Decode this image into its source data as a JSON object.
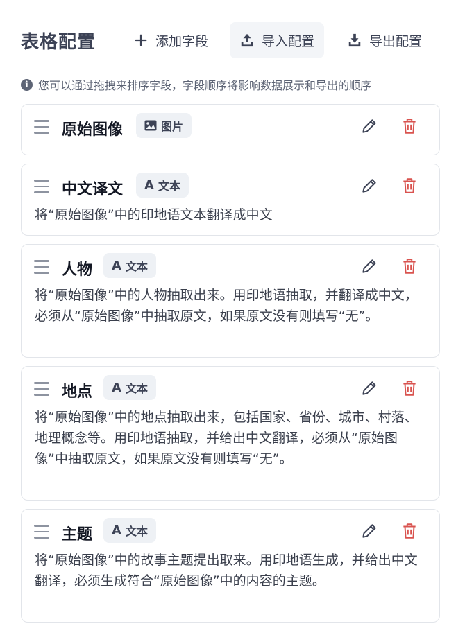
{
  "header": {
    "title": "表格配置",
    "add_field": "添加字段",
    "import_config": "导入配置",
    "export_config": "导出配置"
  },
  "hint": {
    "text": "您可以通过拖拽来排序字段，字段顺序将影响数据展示和导出的顺序"
  },
  "colors": {
    "title": "#3c4255",
    "delete": "#d9534f",
    "edit": "#3c4255",
    "badge_bg": "#eef1f5"
  },
  "fields": [
    {
      "name": "原始图像",
      "type_label": "图片",
      "type_icon": "image-icon",
      "description": ""
    },
    {
      "name": "中文译文",
      "type_label": "文本",
      "type_icon": "text-icon",
      "description": "将“原始图像”中的印地语文本翻译成中文"
    },
    {
      "name": "人物",
      "type_label": "文本",
      "type_icon": "text-icon",
      "description": "将“原始图像”中的人物抽取出来。用印地语抽取，并翻译成中文，必须从“原始图像”中抽取原文，如果原文没有则填写“无”。"
    },
    {
      "name": "地点",
      "type_label": "文本",
      "type_icon": "text-icon",
      "description": "将“原始图像”中的地点抽取出来，包括国家、省份、城市、村落、地理概念等。用印地语抽取，并给出中文翻译，必须从“原始图像”中抽取原文，如果原文没有则填写“无”。"
    },
    {
      "name": "主题",
      "type_label": "文本",
      "type_icon": "text-icon",
      "description": "将“原始图像”中的故事主题提出取来。用印地语生成，并给出中文翻译，必须生成符合“原始图像”中的内容的主题。"
    }
  ]
}
